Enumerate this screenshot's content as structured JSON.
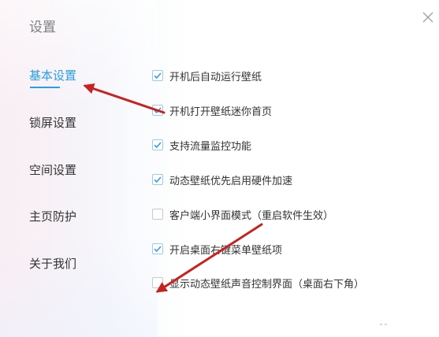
{
  "window": {
    "title": "设置",
    "accent_color": "#2a9df1",
    "close_icon": "close-icon"
  },
  "sidebar": {
    "items": [
      {
        "label": "基本设置",
        "active": true
      },
      {
        "label": "锁屏设置",
        "active": false
      },
      {
        "label": "空间设置",
        "active": false
      },
      {
        "label": "主页防护",
        "active": false
      },
      {
        "label": "关于我们",
        "active": false
      }
    ]
  },
  "options": [
    {
      "label": "开机后自动运行壁纸",
      "checked": true
    },
    {
      "label": "开机打开壁纸迷你首页",
      "checked": true
    },
    {
      "label": "支持流量监控功能",
      "checked": true
    },
    {
      "label": "动态壁纸优先启用硬件加速",
      "checked": true
    },
    {
      "label": "客户端小界面模式（重启软件生效）",
      "checked": false
    },
    {
      "label": "开启桌面右键菜单壁纸项",
      "checked": true
    },
    {
      "label": "显示动态壁纸声音控制界面（桌面右下角）",
      "checked": false
    }
  ],
  "annotation": {
    "arrow_color": "#c8211f"
  }
}
